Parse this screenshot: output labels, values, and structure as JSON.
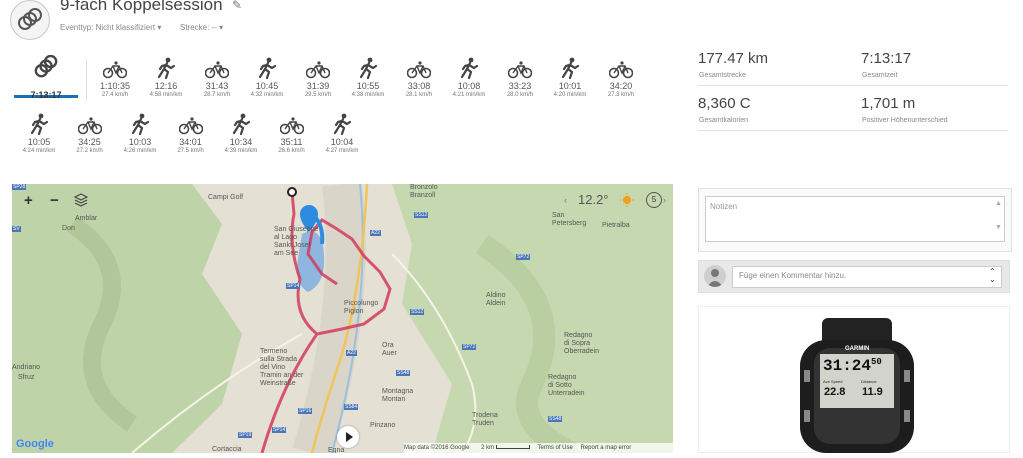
{
  "activity": {
    "title": "9-fach Koppelsession",
    "event_type": "Eventtyp: Nicht klassifiziert",
    "course": "Strecke: --"
  },
  "segments": {
    "total_time": "7:13:17",
    "items": [
      {
        "sport": "bike",
        "time": "1:10:35",
        "pace": "27.4 km/h"
      },
      {
        "sport": "run",
        "time": "12:16",
        "pace": "4:58 min/km"
      },
      {
        "sport": "bike",
        "time": "31:43",
        "pace": "28.7 km/h"
      },
      {
        "sport": "run",
        "time": "10:45",
        "pace": "4:32 min/km"
      },
      {
        "sport": "bike",
        "time": "31:39",
        "pace": "29.5 km/h"
      },
      {
        "sport": "run",
        "time": "10:55",
        "pace": "4:38 min/km"
      },
      {
        "sport": "bike",
        "time": "33:08",
        "pace": "28.1 km/h"
      },
      {
        "sport": "run",
        "time": "10:08",
        "pace": "4:21 min/km"
      },
      {
        "sport": "bike",
        "time": "33:23",
        "pace": "28.0 km/h"
      },
      {
        "sport": "run",
        "time": "10:01",
        "pace": "4:20 min/km"
      },
      {
        "sport": "bike",
        "time": "34:20",
        "pace": "27.3 km/h"
      },
      {
        "sport": "run",
        "time": "10:05",
        "pace": "4:24 min/km"
      },
      {
        "sport": "bike",
        "time": "34:25",
        "pace": "27.2 km/h"
      },
      {
        "sport": "run",
        "time": "10:03",
        "pace": "4:26 min/km"
      },
      {
        "sport": "bike",
        "time": "34:01",
        "pace": "27.5 km/h"
      },
      {
        "sport": "run",
        "time": "10:34",
        "pace": "4:39 min/km"
      },
      {
        "sport": "bike",
        "time": "35:11",
        "pace": "26.6 km/h"
      },
      {
        "sport": "run",
        "time": "10:04",
        "pace": "4:27 min/km"
      }
    ]
  },
  "stats": {
    "distance": {
      "value": "177.47 km",
      "label": "Gesamtstrecke"
    },
    "time": {
      "value": "7:13:17",
      "label": "Gesamtzeit"
    },
    "calories": {
      "value": "8,360 C",
      "label": "Gesamtkalorien"
    },
    "elevation": {
      "value": "1,701 m",
      "label": "Positiver Höhenunterschied"
    }
  },
  "map": {
    "zoom_in": "+",
    "zoom_out": "−",
    "temperature": "12.2°",
    "wind_speed": "5",
    "labels": [
      {
        "id": "campi-golf",
        "text": "Campi Golf"
      },
      {
        "id": "amblar",
        "text": "Amblar"
      },
      {
        "id": "don",
        "text": "Don"
      },
      {
        "id": "bronzolo",
        "text": "Bronzolo\nBranzoll"
      },
      {
        "id": "petersberg",
        "text": "San\nPetersberg"
      },
      {
        "id": "pietralba",
        "text": "Pietralba"
      },
      {
        "id": "caldaro",
        "text": "San Giuseppe\nal Lago\nSankt Josef\nam See"
      },
      {
        "id": "piccolungo",
        "text": "Piccolungo\nPiglon"
      },
      {
        "id": "aldino",
        "text": "Aldino\nAldein"
      },
      {
        "id": "ora",
        "text": "Ora\nAuer"
      },
      {
        "id": "termeno",
        "text": "Termeno\nsulla Strada\ndel Vino\nTramin an der\nWeinstraße"
      },
      {
        "id": "redagno-sopra",
        "text": "Redagno\ndi Sopra\nOberradein"
      },
      {
        "id": "redagno-sotto",
        "text": "Redagno\ndi Sotto\nUnterradein"
      },
      {
        "id": "andriano",
        "text": "Andriano"
      },
      {
        "id": "sfruz",
        "text": "Sfruz"
      },
      {
        "id": "montagna",
        "text": "Montagna\nMontan"
      },
      {
        "id": "trodena",
        "text": "Trodena\nTruden"
      },
      {
        "id": "pinzano",
        "text": "Pinzano"
      },
      {
        "id": "cortaccia",
        "text": "Cortaccia"
      },
      {
        "id": "egna",
        "text": "Egna"
      }
    ],
    "roads": [
      {
        "id": "sp28",
        "text": "SP28"
      },
      {
        "id": "sv",
        "text": "SV"
      },
      {
        "id": "ss12a",
        "text": "SS12"
      },
      {
        "id": "a22a",
        "text": "A22"
      },
      {
        "id": "sp72",
        "text": "SP72"
      },
      {
        "id": "sp14",
        "text": "SP14"
      },
      {
        "id": "ss12b",
        "text": "SS12"
      },
      {
        "id": "a22b",
        "text": "A22"
      },
      {
        "id": "sp72b",
        "text": "SP72"
      },
      {
        "id": "ss48",
        "text": "SS48"
      },
      {
        "id": "sp16",
        "text": "SP16"
      },
      {
        "id": "ss84",
        "text": "SS84"
      },
      {
        "id": "sp19",
        "text": "SP19"
      },
      {
        "id": "sp14b",
        "text": "SP14"
      },
      {
        "id": "sp48",
        "text": "SS48"
      }
    ],
    "brand": "Google",
    "attribution": "Map data ©2016 Google",
    "scale": "2 km",
    "terms": "Terms of Use",
    "report": "Report a map error"
  },
  "notes": {
    "placeholder": "Notizen"
  },
  "comment": {
    "placeholder": "Füge einen Kommentar hinzu."
  },
  "device": {
    "brand": "GARMIN",
    "main_time": "31:24",
    "main_sec": "50",
    "left_label": "Ave Speed",
    "left_value": "22.8",
    "right_label": "Distance",
    "right_value": "11.9"
  },
  "colors": {
    "accent": "#1a6fb5",
    "route": "#d43a5c",
    "icon": "#444444"
  }
}
